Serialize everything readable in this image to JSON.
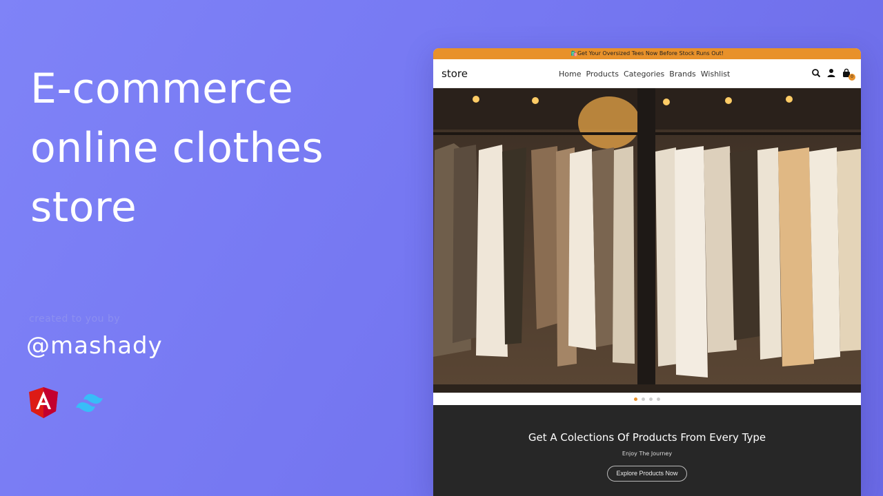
{
  "hero": {
    "title": "E-commerce online clothes store",
    "created_by": "created to you by",
    "author": "@mashady"
  },
  "tech": [
    {
      "icon": "angular-logo-icon",
      "color": "#dd1b16"
    },
    {
      "icon": "tailwind-logo-icon",
      "color": "#38bdf8"
    }
  ],
  "store": {
    "promo": "🛍️Get Your Oversized Tees Now Before Stock Runs Out!",
    "brand": "store",
    "nav": [
      "Home",
      "Products",
      "Categories",
      "Brands",
      "Wishlist"
    ],
    "icons": [
      "search-icon",
      "user-icon",
      "cart-icon"
    ],
    "cart_count": "0",
    "slider": {
      "dots": 4,
      "active_index": 0
    },
    "cta": {
      "title": "Get A Colections Of Products From Every Type",
      "subtitle": "Enjoy The Journey",
      "button": "Explore Products Now"
    }
  },
  "colors": {
    "accent": "#e8912a",
    "background": "#7678f2",
    "cta_bg": "#272727"
  }
}
